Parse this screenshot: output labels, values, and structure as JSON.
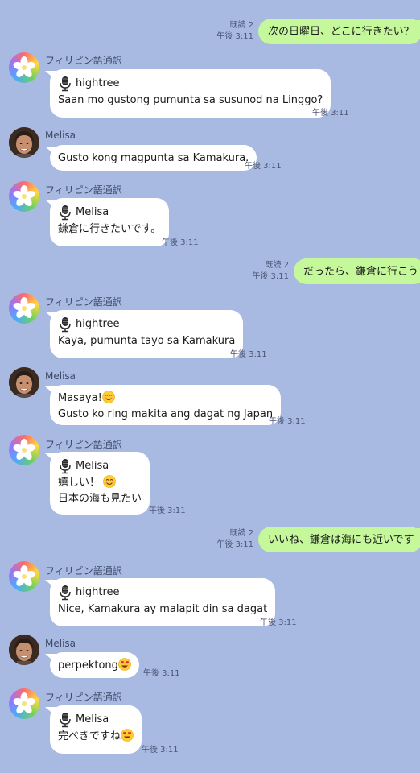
{
  "messages": [
    {
      "kind": "out",
      "read": "既読 2",
      "time": "午後 3:11",
      "text": "次の日曜日、どこに行きたい？"
    },
    {
      "kind": "bot",
      "sender": "フィリピン語通訳",
      "speaker": "hightree",
      "text": "Saan mo gustong pumunta sa susunod na Linggo?",
      "time": "午後 3:11"
    },
    {
      "kind": "person",
      "sender": "Melisa",
      "text": "Gusto kong magpunta sa Kamakura.",
      "time": "午後 3:11"
    },
    {
      "kind": "bot",
      "sender": "フィリピン語通訳",
      "speaker": "Melisa",
      "text": "鎌倉に行きたいです。",
      "time": "午後 3:11"
    },
    {
      "kind": "out",
      "read": "既読 2",
      "time": "午後 3:11",
      "text": "だったら、鎌倉に行こう"
    },
    {
      "kind": "bot",
      "sender": "フィリピン語通訳",
      "speaker": "hightree",
      "text": "Kaya, pumunta tayo sa Kamakura",
      "time": "午後 3:11"
    },
    {
      "kind": "person",
      "sender": "Melisa",
      "line1": "Masaya!",
      "line2": "Gusto ko ring makita ang dagat ng Japan",
      "time": "午後 3:11"
    },
    {
      "kind": "bot",
      "sender": "フィリピン語通訳",
      "speaker": "Melisa",
      "line1": "嬉しい！",
      "line2": "日本の海も見たい",
      "time": "午後 3:11"
    },
    {
      "kind": "out",
      "read": "既読 2",
      "time": "午後 3:11",
      "text": "いいね、鎌倉は海にも近いです"
    },
    {
      "kind": "bot",
      "sender": "フィリピン語通訳",
      "speaker": "hightree",
      "text": "Nice, Kamakura ay malapit din sa dagat",
      "time": "午後 3:11"
    },
    {
      "kind": "person",
      "sender": "Melisa",
      "text": "perpektong",
      "time": "午後 3:11"
    },
    {
      "kind": "bot",
      "sender": "フィリピン語通訳",
      "speaker": "Melisa",
      "text": "完ぺきですね",
      "time": "午後 3:11"
    }
  ],
  "icons": {
    "bot_avatar": "flower-logo-icon",
    "person_avatar": "user-photo-avatar",
    "voice": "microphone-icon",
    "smile": "smiling-face-emoji",
    "heart_eyes": "heart-eyes-emoji"
  },
  "colors": {
    "background": "#a8b9e2",
    "incoming_bubble": "#ffffff",
    "outgoing_bubble": "#c5f79b"
  }
}
